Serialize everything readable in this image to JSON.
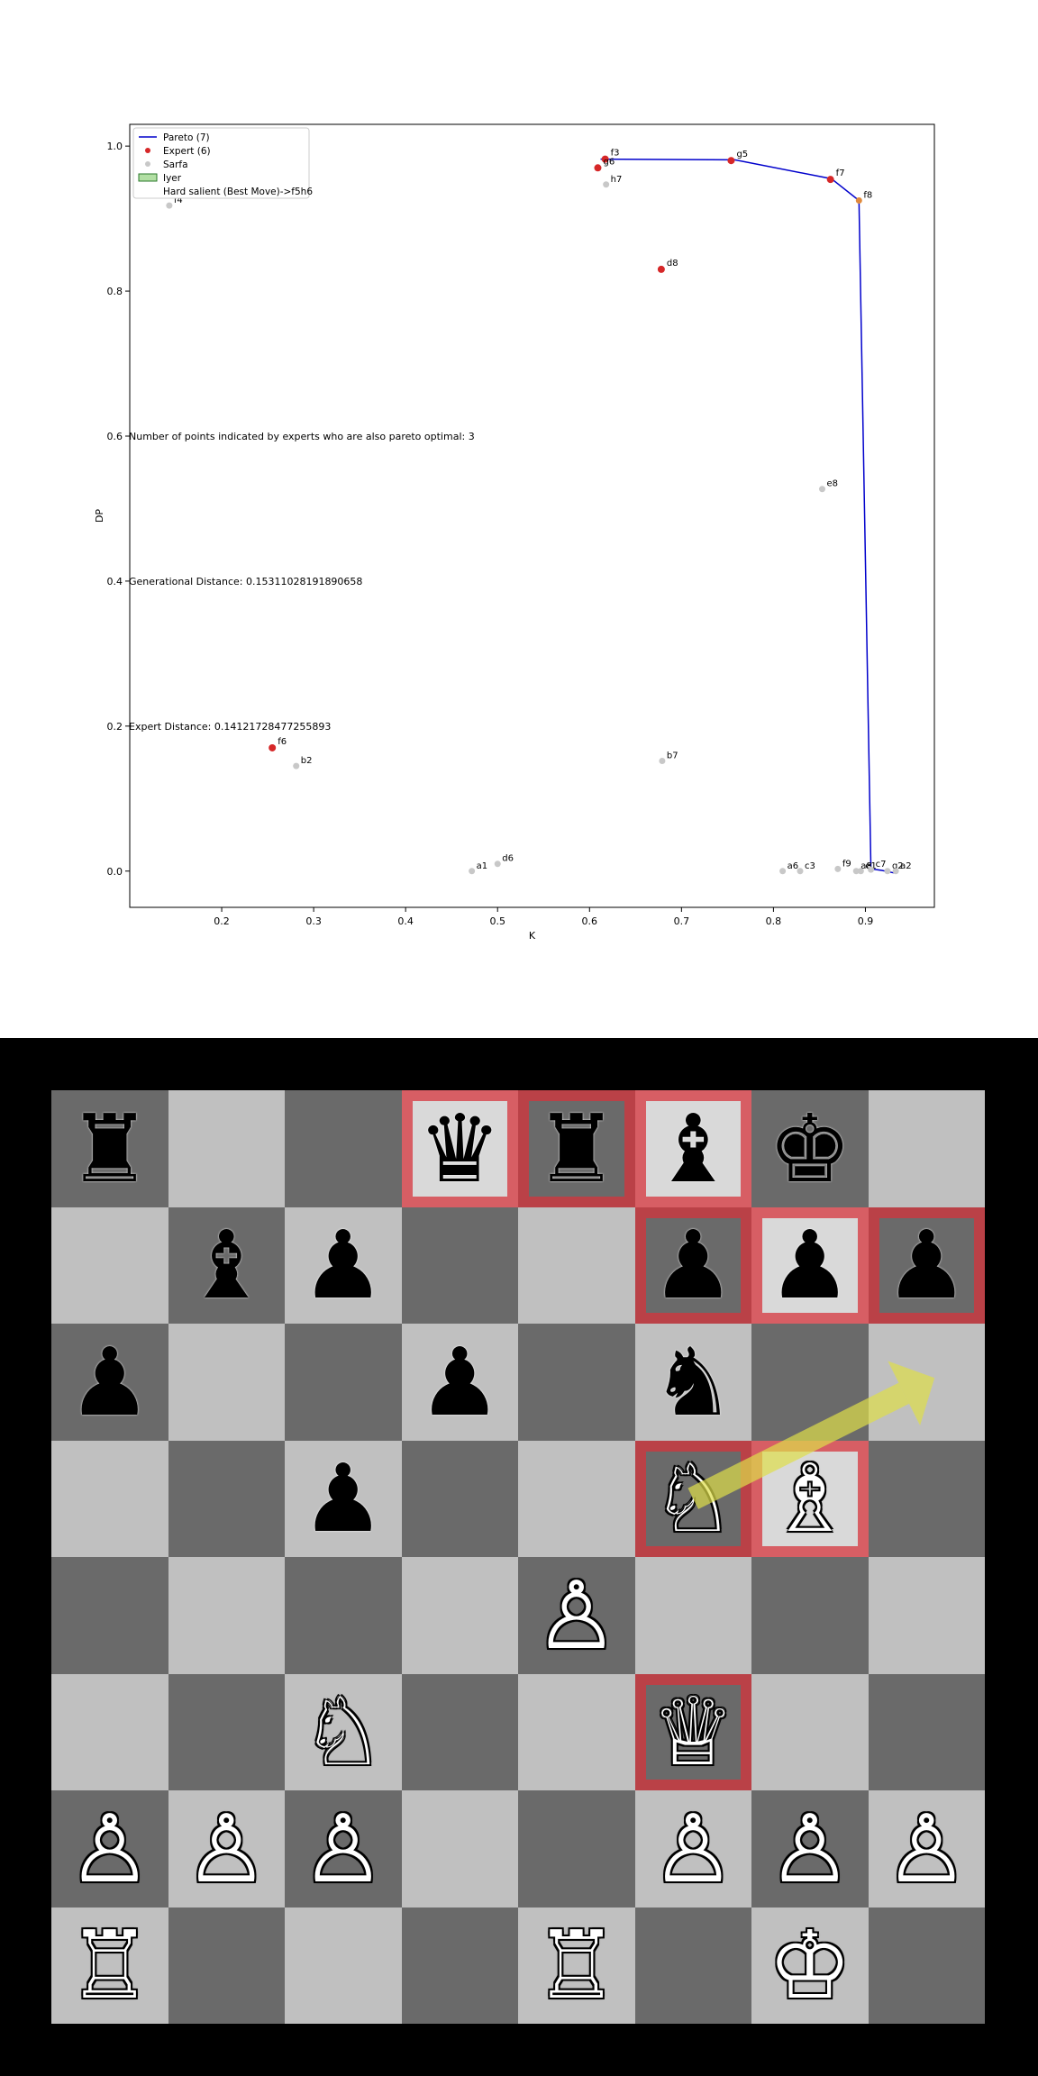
{
  "colors": {
    "pareto": "#0000cc",
    "expert": "#d62728",
    "sarfa": "#c8c8c8",
    "iyer_fill": "#b2dfa4",
    "highlight": "#d6343c",
    "arrow": "#dede4a"
  },
  "chart_data": {
    "type": "scatter",
    "title": "",
    "xlabel": "K",
    "ylabel": "DP",
    "xlim": [
      0.1,
      0.975
    ],
    "ylim": [
      -0.05,
      1.03
    ],
    "xticks": [
      "0.2",
      "0.3",
      "0.4",
      "0.5",
      "0.6",
      "0.7",
      "0.8",
      "0.9"
    ],
    "yticks": [
      "0.0",
      "0.2",
      "0.4",
      "0.6",
      "0.8",
      "1.0"
    ],
    "legend_position": "top-left",
    "legend": [
      {
        "label": "Pareto (7)",
        "kind": "line"
      },
      {
        "label": "Expert (6)",
        "kind": "expert"
      },
      {
        "label": "Sarfa",
        "kind": "sarfa"
      },
      {
        "label": "Iyer",
        "kind": "iyer"
      },
      {
        "label": "Hard salient (Best Move)->f5h6",
        "kind": "none"
      }
    ],
    "annotations": [
      "Number of points indicated by experts who are also pareto optimal: 3",
      "Generational Distance: 0.15311028191890658",
      "Expert Distance: 0.14121728477255893"
    ],
    "pareto_line": [
      {
        "x": 0.612,
        "y": 0.982
      },
      {
        "x": 0.758,
        "y": 0.981
      },
      {
        "x": 0.863,
        "y": 0.955
      },
      {
        "x": 0.893,
        "y": 0.925
      },
      {
        "x": 0.906,
        "y": 0.003
      },
      {
        "x": 0.918,
        "y": 0.001
      },
      {
        "x": 0.933,
        "y": -0.003
      }
    ],
    "sarfa_points": [
      {
        "label": "f4",
        "x": 0.143,
        "y": 0.918
      },
      {
        "label": "h7",
        "x": 0.618,
        "y": 0.947
      },
      {
        "label": "e8",
        "x": 0.853,
        "y": 0.527
      },
      {
        "label": "b2",
        "x": 0.281,
        "y": 0.145
      },
      {
        "label": "b7",
        "x": 0.679,
        "y": 0.152
      },
      {
        "label": "a1",
        "x": 0.472,
        "y": 0.0
      },
      {
        "label": "d6",
        "x": 0.5,
        "y": 0.01
      },
      {
        "label": "a6",
        "x": 0.81,
        "y": 0.0
      },
      {
        "label": "c3",
        "x": 0.829,
        "y": 0.0
      },
      {
        "label": "f9",
        "x": 0.87,
        "y": 0.003
      },
      {
        "label": "a8",
        "x": 0.89,
        "y": 0.0
      },
      {
        "label": "e1",
        "x": 0.895,
        "y": 0.0
      },
      {
        "label": "c7",
        "x": 0.906,
        "y": 0.002
      },
      {
        "label": "g2",
        "x": 0.924,
        "y": 0.0
      },
      {
        "label": "a2",
        "x": 0.933,
        "y": 0.0
      }
    ],
    "expert_points": [
      {
        "label": "f3",
        "x": 0.617,
        "y": 0.982
      },
      {
        "label": "g6",
        "x": 0.609,
        "y": 0.97
      },
      {
        "label": "g5",
        "x": 0.754,
        "y": 0.98
      },
      {
        "label": "f7",
        "x": 0.862,
        "y": 0.954
      },
      {
        "label": "d8",
        "x": 0.678,
        "y": 0.83
      },
      {
        "label": "f6",
        "x": 0.255,
        "y": 0.17
      }
    ],
    "iyer_points": [
      {
        "label": "f8",
        "x": 0.893,
        "y": 0.925
      }
    ]
  },
  "board": {
    "squares": [
      {
        "sq": "a8",
        "piece": "♜",
        "side": "b",
        "hl": false
      },
      {
        "sq": "d8",
        "piece": "♛",
        "side": "b",
        "hl": true
      },
      {
        "sq": "e8",
        "piece": "♜",
        "side": "b",
        "hl": true
      },
      {
        "sq": "f8",
        "piece": "♝",
        "side": "b",
        "hl": true
      },
      {
        "sq": "g8",
        "piece": "♚",
        "side": "b",
        "hl": false
      },
      {
        "sq": "b7",
        "piece": "♝",
        "side": "b",
        "hl": false
      },
      {
        "sq": "c7",
        "piece": "♟",
        "side": "b",
        "hl": false
      },
      {
        "sq": "f7",
        "piece": "♟",
        "side": "b",
        "hl": true
      },
      {
        "sq": "g7",
        "piece": "♟",
        "side": "b",
        "hl": true
      },
      {
        "sq": "h7",
        "piece": "♟",
        "side": "b",
        "hl": true
      },
      {
        "sq": "a6",
        "piece": "♟",
        "side": "b",
        "hl": false
      },
      {
        "sq": "d6",
        "piece": "♟",
        "side": "b",
        "hl": false
      },
      {
        "sq": "f6",
        "piece": "♞",
        "side": "b",
        "hl": false
      },
      {
        "sq": "c5",
        "piece": "♟",
        "side": "b",
        "hl": false
      },
      {
        "sq": "f5",
        "piece": "♘",
        "side": "w",
        "hl": true
      },
      {
        "sq": "g5",
        "piece": "♗",
        "side": "w",
        "hl": true
      },
      {
        "sq": "e4",
        "piece": "♙",
        "side": "w",
        "hl": false
      },
      {
        "sq": "c3",
        "piece": "♘",
        "side": "w",
        "hl": false
      },
      {
        "sq": "f3",
        "piece": "♕",
        "side": "w",
        "hl": true
      },
      {
        "sq": "a2",
        "piece": "♙",
        "side": "w",
        "hl": false
      },
      {
        "sq": "b2",
        "piece": "♙",
        "side": "w",
        "hl": false
      },
      {
        "sq": "c2",
        "piece": "♙",
        "side": "w",
        "hl": false
      },
      {
        "sq": "f2",
        "piece": "♙",
        "side": "w",
        "hl": false
      },
      {
        "sq": "g2",
        "piece": "♙",
        "side": "w",
        "hl": false
      },
      {
        "sq": "h2",
        "piece": "♙",
        "side": "w",
        "hl": false
      },
      {
        "sq": "a1",
        "piece": "♖",
        "side": "w",
        "hl": false
      },
      {
        "sq": "e1",
        "piece": "♖",
        "side": "w",
        "hl": false
      },
      {
        "sq": "g1",
        "piece": "♔",
        "side": "w",
        "hl": false
      }
    ],
    "arrow": {
      "from": "f5",
      "to": "h6"
    }
  }
}
